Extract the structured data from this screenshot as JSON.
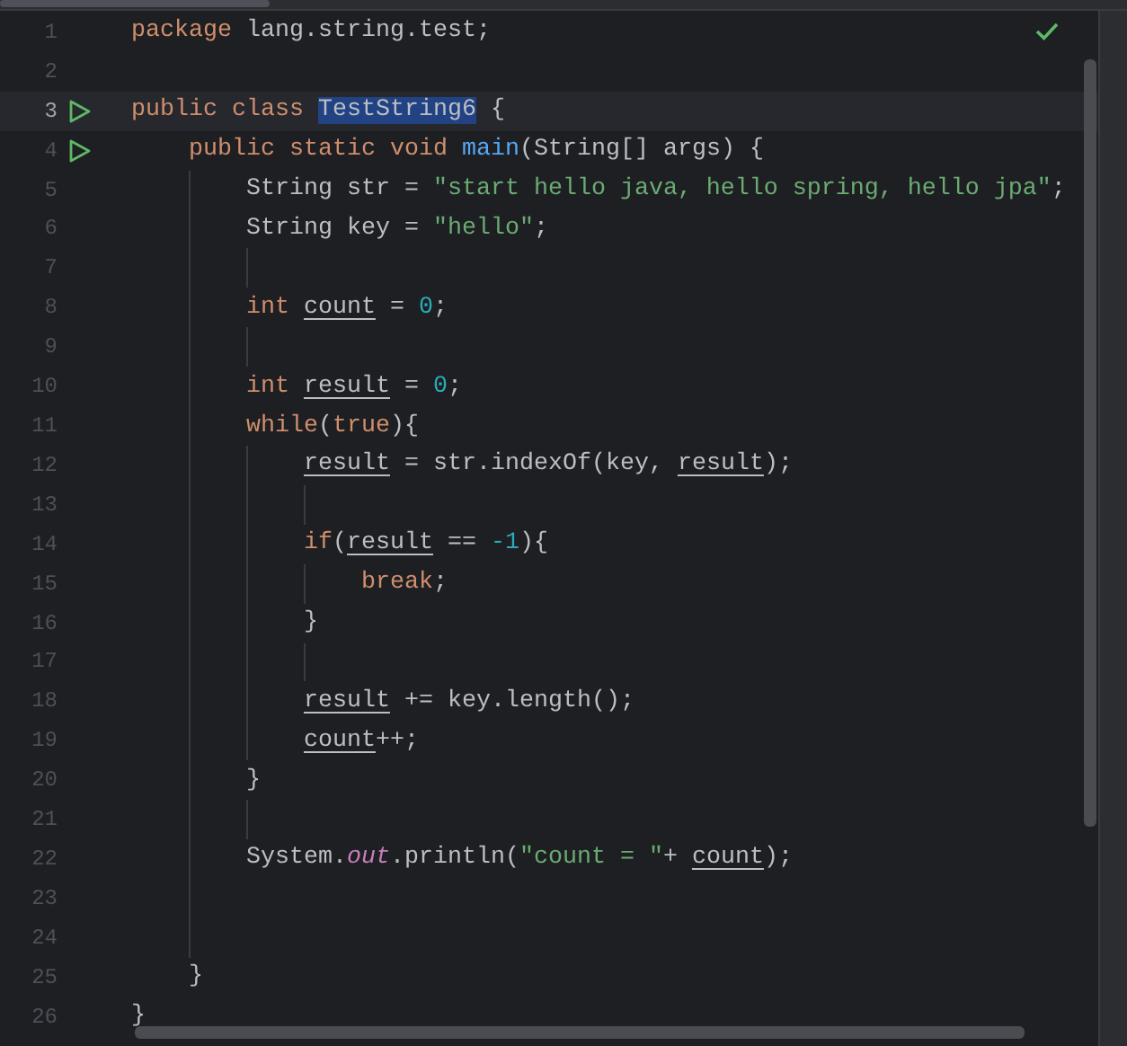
{
  "editor": {
    "no_problems": true,
    "lines": [
      {
        "number": "1",
        "runnable": false,
        "current": false,
        "tokens": [
          {
            "kind": "keyword",
            "text": "package"
          },
          {
            "kind": "plain",
            "text": " lang.string.test;"
          }
        ]
      },
      {
        "number": "2",
        "runnable": false,
        "current": false
      },
      {
        "number": "3",
        "runnable": true,
        "current": true,
        "tokens": [
          {
            "kind": "keyword",
            "text": "public class "
          },
          {
            "kind": "selection",
            "text": "TestString6"
          },
          {
            "kind": "plain",
            "text": " {"
          }
        ]
      },
      {
        "number": "4",
        "runnable": true,
        "current": false,
        "tokens": [
          {
            "kind": "keyword",
            "text": "    public static void "
          },
          {
            "kind": "method",
            "text": "main"
          },
          {
            "kind": "plain",
            "text": "(String[] args) {"
          }
        ]
      },
      {
        "number": "5",
        "runnable": false,
        "current": false,
        "tokens": [
          {
            "kind": "plain",
            "text": "        String str = "
          },
          {
            "kind": "string",
            "text": "\"start hello java, hello spring, hello jpa\""
          },
          {
            "kind": "plain",
            "text": ";"
          }
        ]
      },
      {
        "number": "6",
        "runnable": false,
        "current": false,
        "tokens": [
          {
            "kind": "plain",
            "text": "        String key = "
          },
          {
            "kind": "string",
            "text": "\"hello\""
          },
          {
            "kind": "plain",
            "text": ";"
          }
        ]
      },
      {
        "number": "7",
        "runnable": false,
        "current": false
      },
      {
        "number": "8",
        "runnable": false,
        "current": false,
        "tokens": [
          {
            "kind": "keyword",
            "text": "        int "
          },
          {
            "kind": "var",
            "text": "count"
          },
          {
            "kind": "plain",
            "text": " = "
          },
          {
            "kind": "number",
            "text": "0"
          },
          {
            "kind": "plain",
            "text": ";"
          }
        ]
      },
      {
        "number": "9",
        "runnable": false,
        "current": false
      },
      {
        "number": "10",
        "runnable": false,
        "current": false,
        "tokens": [
          {
            "kind": "keyword",
            "text": "        int "
          },
          {
            "kind": "var",
            "text": "result"
          },
          {
            "kind": "plain",
            "text": " = "
          },
          {
            "kind": "number",
            "text": "0"
          },
          {
            "kind": "plain",
            "text": ";"
          }
        ]
      },
      {
        "number": "11",
        "runnable": false,
        "current": false,
        "tokens": [
          {
            "kind": "keyword",
            "text": "        while"
          },
          {
            "kind": "plain",
            "text": "("
          },
          {
            "kind": "keyword",
            "text": "true"
          },
          {
            "kind": "plain",
            "text": "){"
          }
        ]
      },
      {
        "number": "12",
        "runnable": false,
        "current": false,
        "tokens": [
          {
            "kind": "var",
            "text": "            result"
          },
          {
            "kind": "plain",
            "text": " = str.indexOf(key, "
          },
          {
            "kind": "var",
            "text": "result"
          },
          {
            "kind": "plain",
            "text": ");"
          }
        ]
      },
      {
        "number": "13",
        "runnable": false,
        "current": false
      },
      {
        "number": "14",
        "runnable": false,
        "current": false,
        "tokens": [
          {
            "kind": "keyword",
            "text": "            if"
          },
          {
            "kind": "plain",
            "text": "("
          },
          {
            "kind": "var",
            "text": "result"
          },
          {
            "kind": "plain",
            "text": " == "
          },
          {
            "kind": "number",
            "text": "-1"
          },
          {
            "kind": "plain",
            "text": "){"
          }
        ]
      },
      {
        "number": "15",
        "runnable": false,
        "current": false,
        "tokens": [
          {
            "kind": "keyword",
            "text": "                break"
          },
          {
            "kind": "plain",
            "text": ";"
          }
        ]
      },
      {
        "number": "16",
        "runnable": false,
        "current": false,
        "tokens": [
          {
            "kind": "plain",
            "text": "            }"
          }
        ]
      },
      {
        "number": "17",
        "runnable": false,
        "current": false
      },
      {
        "number": "18",
        "runnable": false,
        "current": false,
        "tokens": [
          {
            "kind": "var",
            "text": "            result"
          },
          {
            "kind": "plain",
            "text": " += key.length();"
          }
        ]
      },
      {
        "number": "19",
        "runnable": false,
        "current": false,
        "tokens": [
          {
            "kind": "var",
            "text": "            count"
          },
          {
            "kind": "plain",
            "text": "++;"
          }
        ]
      },
      {
        "number": "20",
        "runnable": false,
        "current": false,
        "tokens": [
          {
            "kind": "plain",
            "text": "        }"
          }
        ]
      },
      {
        "number": "21",
        "runnable": false,
        "current": false
      },
      {
        "number": "22",
        "runnable": false,
        "current": false,
        "tokens": [
          {
            "kind": "plain",
            "text": "        System."
          },
          {
            "kind": "field",
            "text": "out"
          },
          {
            "kind": "plain",
            "text": ".println("
          },
          {
            "kind": "string",
            "text": "\"count = \""
          },
          {
            "kind": "plain",
            "text": "+ "
          },
          {
            "kind": "var",
            "text": "count"
          },
          {
            "kind": "plain",
            "text": ");"
          }
        ]
      },
      {
        "number": "23",
        "runnable": false,
        "current": false
      },
      {
        "number": "24",
        "runnable": false,
        "current": false
      },
      {
        "number": "25",
        "runnable": false,
        "current": false,
        "tokens": [
          {
            "kind": "plain",
            "text": "    }"
          }
        ]
      },
      {
        "number": "26",
        "runnable": false,
        "current": false,
        "tokens": [
          {
            "kind": "plain",
            "text": "}"
          }
        ]
      }
    ]
  }
}
